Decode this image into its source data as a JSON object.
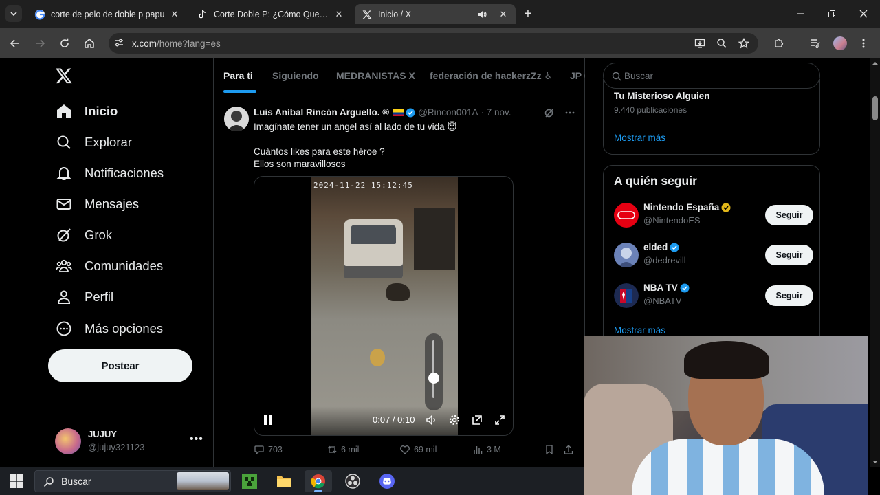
{
  "browser": {
    "tabs": [
      {
        "title": "corte de pelo de doble p papu",
        "favicon": "google-icon",
        "active": false
      },
      {
        "title": "Corte Doble P: ¿Cómo Quedó e",
        "favicon": "tiktok-icon",
        "active": false
      },
      {
        "title": "Inicio / X",
        "favicon": "x-icon",
        "active": true,
        "audio": true
      }
    ],
    "url_host": "x.com",
    "url_path": "/home?lang=es"
  },
  "nav": {
    "items": [
      {
        "label": "Inicio",
        "icon": "home-icon"
      },
      {
        "label": "Explorar",
        "icon": "search-icon"
      },
      {
        "label": "Notificaciones",
        "icon": "bell-icon"
      },
      {
        "label": "Mensajes",
        "icon": "mail-icon"
      },
      {
        "label": "Grok",
        "icon": "grok-icon"
      },
      {
        "label": "Comunidades",
        "icon": "communities-icon"
      },
      {
        "label": "Perfil",
        "icon": "person-icon"
      },
      {
        "label": "Más opciones",
        "icon": "more-circle-icon"
      }
    ],
    "post_label": "Postear",
    "account": {
      "name": "JUJUY",
      "handle": "@jujuy321123"
    }
  },
  "timeline": {
    "tabs": [
      "Para ti",
      "Siguiendo",
      "MEDRANISTAS X",
      "federación de hackerzZz ♿",
      "JP C"
    ],
    "tweet": {
      "name": "Luis Aníbal Rincón Arguello. ®",
      "handle": "@Rincon001A",
      "date": "· 7 nov.",
      "line1": "Imagínate tener un angel así al lado de tu vida 😇",
      "line2": "Cuántos likes para este héroe ?",
      "line3": "Ellos son maravillosos",
      "video_timestamp": "2024-11-22 15:12:45",
      "video_time": "0:07 / 0:10",
      "volume_level": 0.35,
      "replies": "703",
      "reposts": "6 mil",
      "likes": "69 mil",
      "views": "3 M"
    }
  },
  "right": {
    "search_placeholder": "Buscar",
    "trend": {
      "name": "Tu Misterioso Alguien",
      "count": "9.440 publicaciones"
    },
    "show_more_1": "Mostrar más",
    "who_to_follow_title": "A quién seguir",
    "follow": [
      {
        "name": "Nintendo España",
        "handle": "@NintendoES",
        "badge": "gold",
        "button": "Seguir"
      },
      {
        "name": "elded",
        "handle": "@dedrevill",
        "badge": "blue",
        "button": "Seguir"
      },
      {
        "name": "NBA TV",
        "handle": "@NBATV",
        "badge": "blue",
        "button": "Seguir"
      }
    ],
    "show_more_2": "Mostrar más"
  },
  "taskbar": {
    "search_label": "Buscar"
  },
  "colors": {
    "accent": "#1d9bf0",
    "bg": "#000000",
    "muted": "#71767b",
    "gold": "#e2b719"
  }
}
